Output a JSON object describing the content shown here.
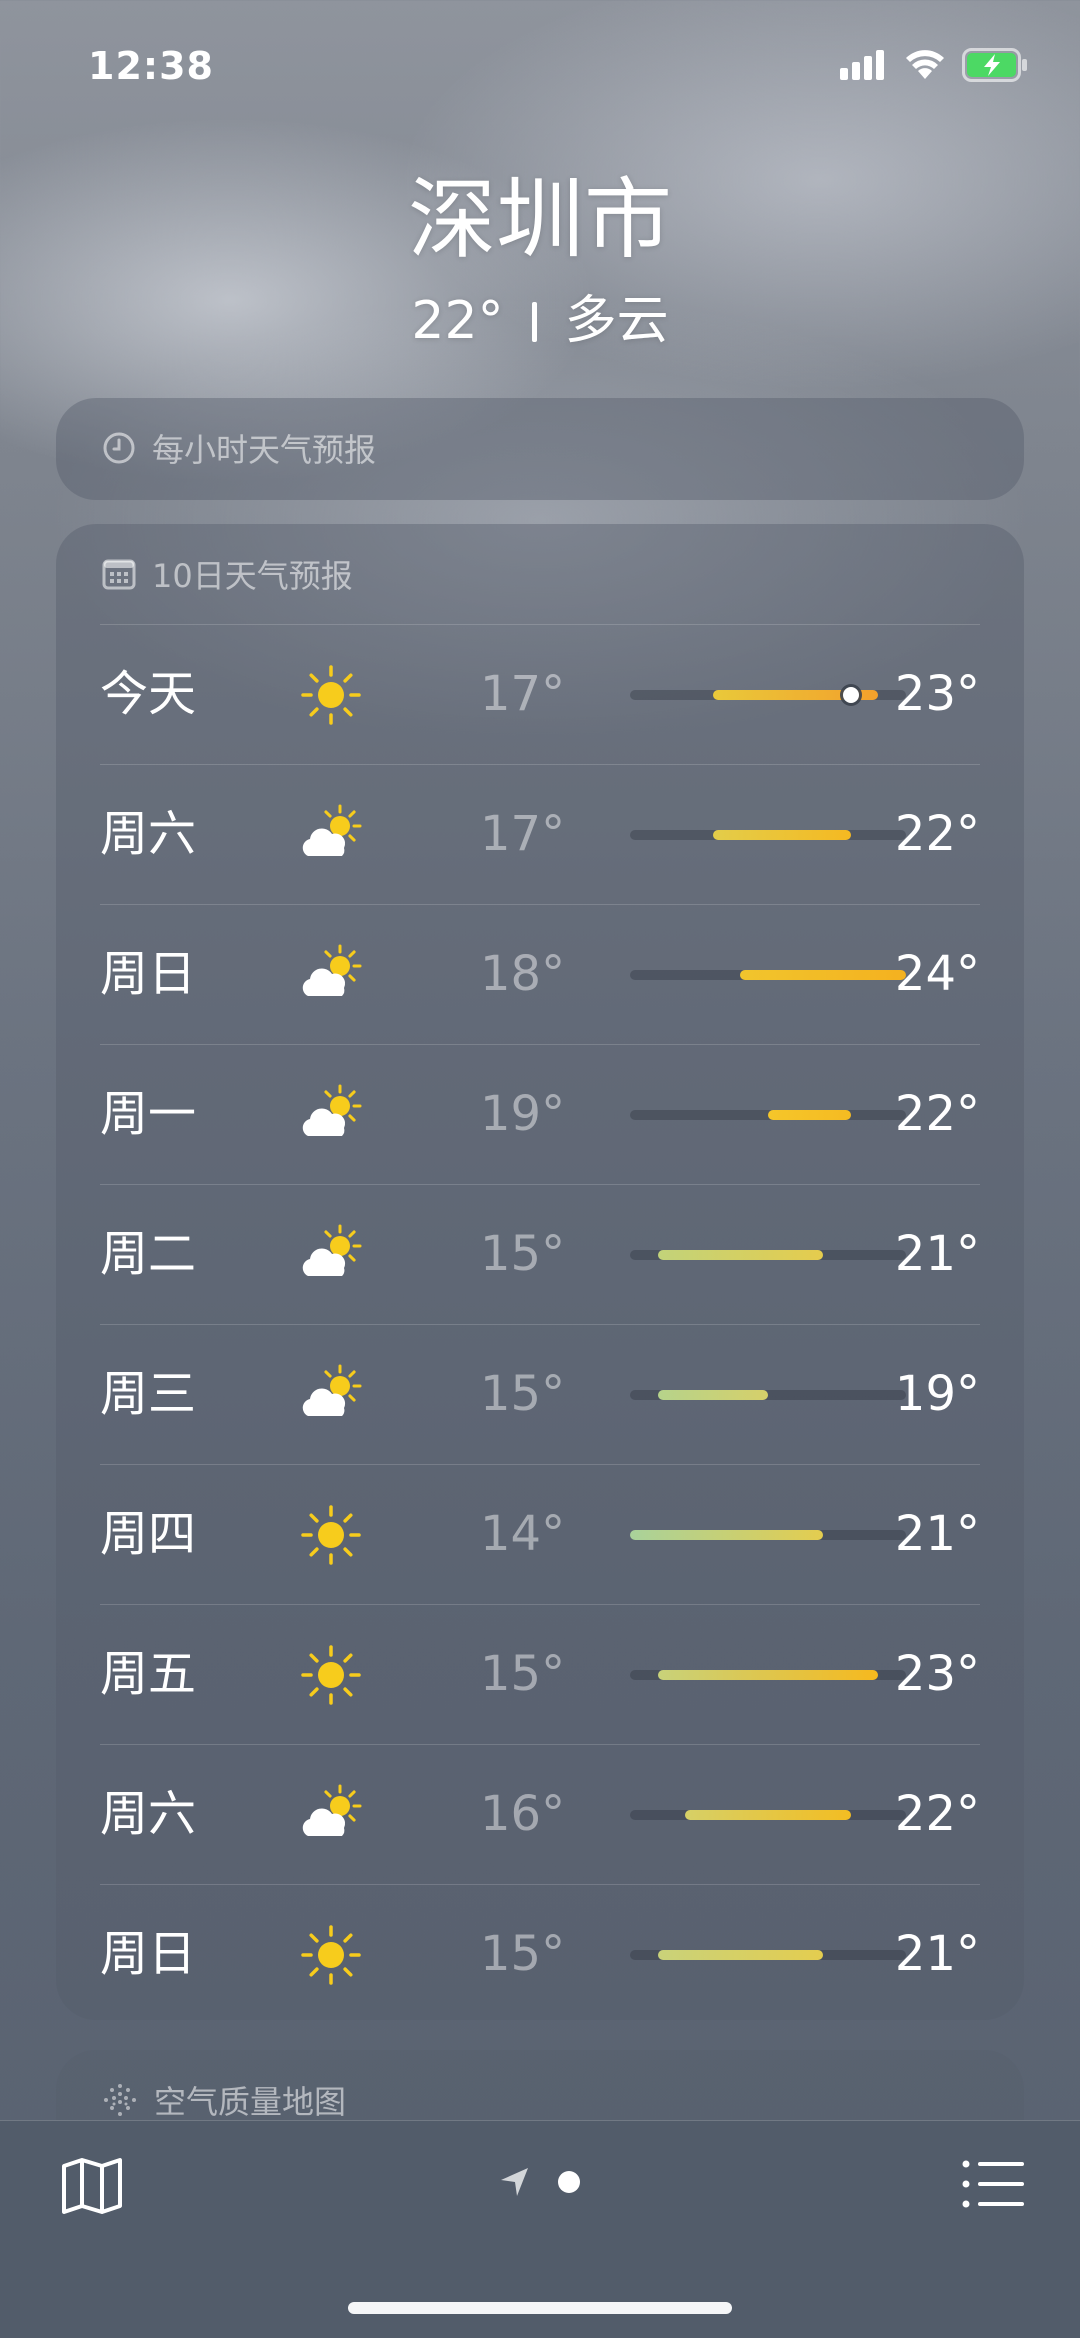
{
  "status_bar": {
    "time": "12:38"
  },
  "location": {
    "city": "深圳市",
    "temperature": "22°",
    "condition": "多云"
  },
  "hourly_card": {
    "title": "每小时天气预报"
  },
  "ten_day_card": {
    "title": "10日天气预报",
    "scale": {
      "min": 14,
      "max": 24
    },
    "current_temp": 22,
    "days": [
      {
        "day": "今天",
        "icon": "sun-icon",
        "low": "17°",
        "high": "23°",
        "low_value": 17,
        "high_value": 23,
        "colors": [
          "#e9c93a",
          "#f3a02b"
        ]
      },
      {
        "day": "周六",
        "icon": "partly-cloudy-icon",
        "low": "17°",
        "high": "22°",
        "low_value": 17,
        "high_value": 22,
        "colors": [
          "#e3cd4a",
          "#f5b921"
        ]
      },
      {
        "day": "周日",
        "icon": "partly-cloudy-icon",
        "low": "18°",
        "high": "24°",
        "low_value": 18,
        "high_value": 24,
        "colors": [
          "#f1c52d",
          "#f4b11f"
        ]
      },
      {
        "day": "周一",
        "icon": "partly-cloudy-icon",
        "low": "19°",
        "high": "22°",
        "low_value": 19,
        "high_value": 22,
        "colors": [
          "#f5c62a",
          "#f5bb22"
        ]
      },
      {
        "day": "周二",
        "icon": "partly-cloudy-icon",
        "low": "15°",
        "high": "21°",
        "low_value": 15,
        "high_value": 21,
        "colors": [
          "#c2d37a",
          "#e5cc4d"
        ]
      },
      {
        "day": "周三",
        "icon": "partly-cloudy-icon",
        "low": "15°",
        "high": "19°",
        "low_value": 15,
        "high_value": 19,
        "colors": [
          "#b6d38b",
          "#d6d06a"
        ]
      },
      {
        "day": "周四",
        "icon": "sun-icon",
        "low": "14°",
        "high": "21°",
        "low_value": 14,
        "high_value": 21,
        "colors": [
          "#a9d29b",
          "#e4cd4f"
        ]
      },
      {
        "day": "周五",
        "icon": "sun-icon",
        "low": "15°",
        "high": "23°",
        "low_value": 15,
        "high_value": 23,
        "colors": [
          "#c8d27a",
          "#f6b91e"
        ]
      },
      {
        "day": "周六",
        "icon": "partly-cloudy-icon",
        "low": "16°",
        "high": "22°",
        "low_value": 16,
        "high_value": 22,
        "colors": [
          "#d6d067",
          "#f3bd22"
        ]
      },
      {
        "day": "周日",
        "icon": "sun-icon",
        "low": "15°",
        "high": "21°",
        "low_value": 15,
        "high_value": 21,
        "colors": [
          "#c9d27a",
          "#e4cd4f"
        ]
      }
    ]
  },
  "air_quality_card": {
    "title": "空气质量地图"
  },
  "tab_bar": {
    "map_icon": "map-icon",
    "location_icon": "location-arrow-icon",
    "list_icon": "list-icon"
  }
}
